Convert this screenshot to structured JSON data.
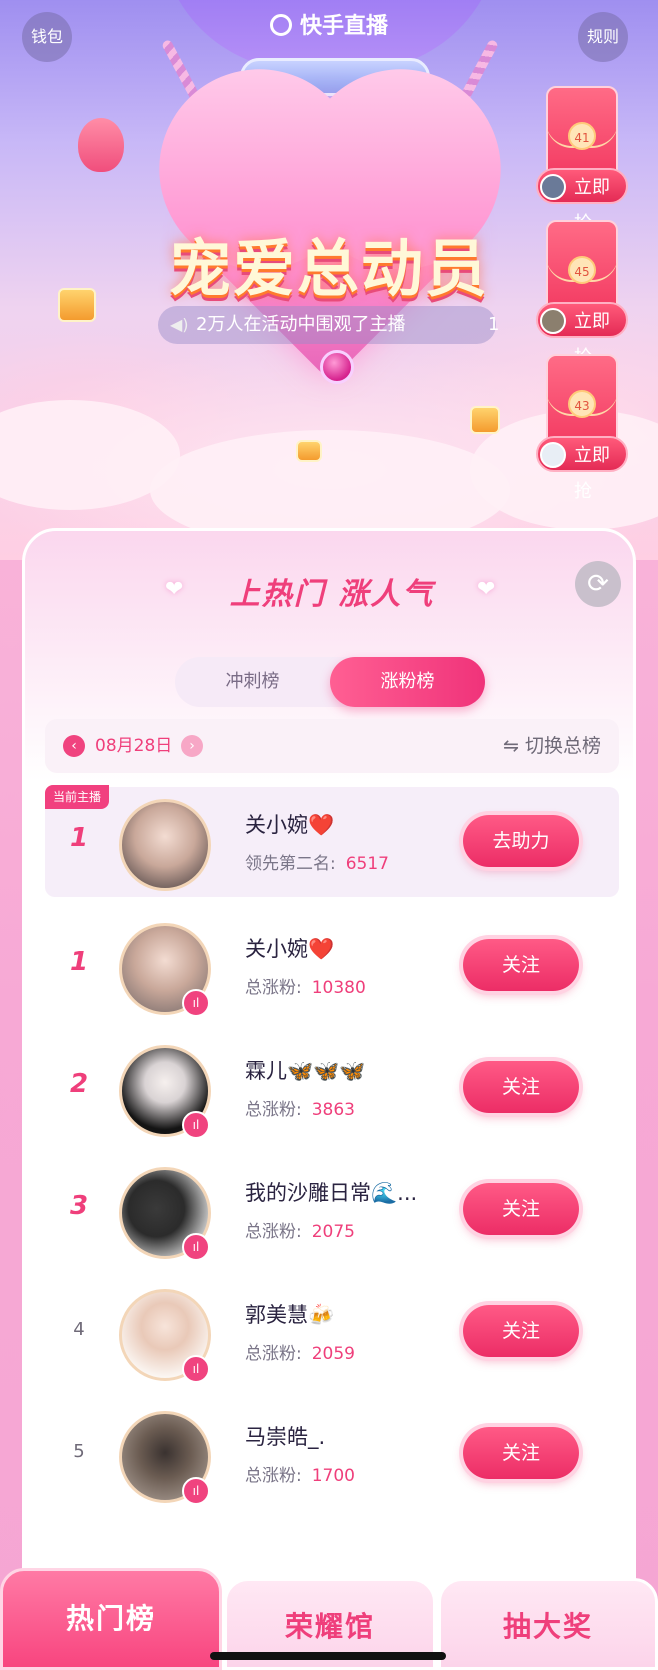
{
  "header": {
    "wallet_label": "钱包",
    "app_title": "快手直播",
    "rules_label": "规则"
  },
  "event": {
    "title": "宠爱总动员",
    "ticker_text": "2万人在活动中围观了主播",
    "ticker_tail": "1"
  },
  "red_packets": [
    {
      "count": "41",
      "button": "立即抢"
    },
    {
      "count": "45",
      "button": "立即抢"
    },
    {
      "count": "43",
      "button": "立即抢"
    }
  ],
  "board": {
    "title": "上热门 涨人气",
    "tabs": [
      {
        "label": "冲刺榜",
        "active": false
      },
      {
        "label": "涨粉榜",
        "active": true
      }
    ],
    "date": "08月28日",
    "switch_label": "⇋ 切换总榜"
  },
  "current": {
    "tag": "当前主播",
    "rank": "1",
    "name": "关小婉❤️",
    "stat_label": "领先第二名:",
    "stat_value": "6517",
    "button": "去助力"
  },
  "rows": [
    {
      "rank": "1",
      "name": "关小婉❤️",
      "stat_label": "总涨粉:",
      "stat_value": "10380",
      "button": "关注"
    },
    {
      "rank": "2",
      "name": "霖儿🦋🦋🦋",
      "stat_label": "总涨粉:",
      "stat_value": "3863",
      "button": "关注"
    },
    {
      "rank": "3",
      "name": "我的沙雕日常🌊...",
      "stat_label": "总涨粉:",
      "stat_value": "2075",
      "button": "关注"
    },
    {
      "rank": "4",
      "name": "郭美慧🍻",
      "stat_label": "总涨粉:",
      "stat_value": "2059",
      "button": "关注"
    },
    {
      "rank": "5",
      "name": "马崇皓_.",
      "stat_label": "总涨粉:",
      "stat_value": "1700",
      "button": "关注"
    }
  ],
  "bottom_nav": [
    {
      "label": "热门榜",
      "active": true
    },
    {
      "label": "荣耀馆",
      "active": false
    },
    {
      "label": "抽大奖",
      "active": false
    }
  ],
  "colors": {
    "accent": "#ef3f7b",
    "button": "#ec2d66",
    "text_dark": "#2a2340",
    "text_muted": "#7a7588"
  }
}
